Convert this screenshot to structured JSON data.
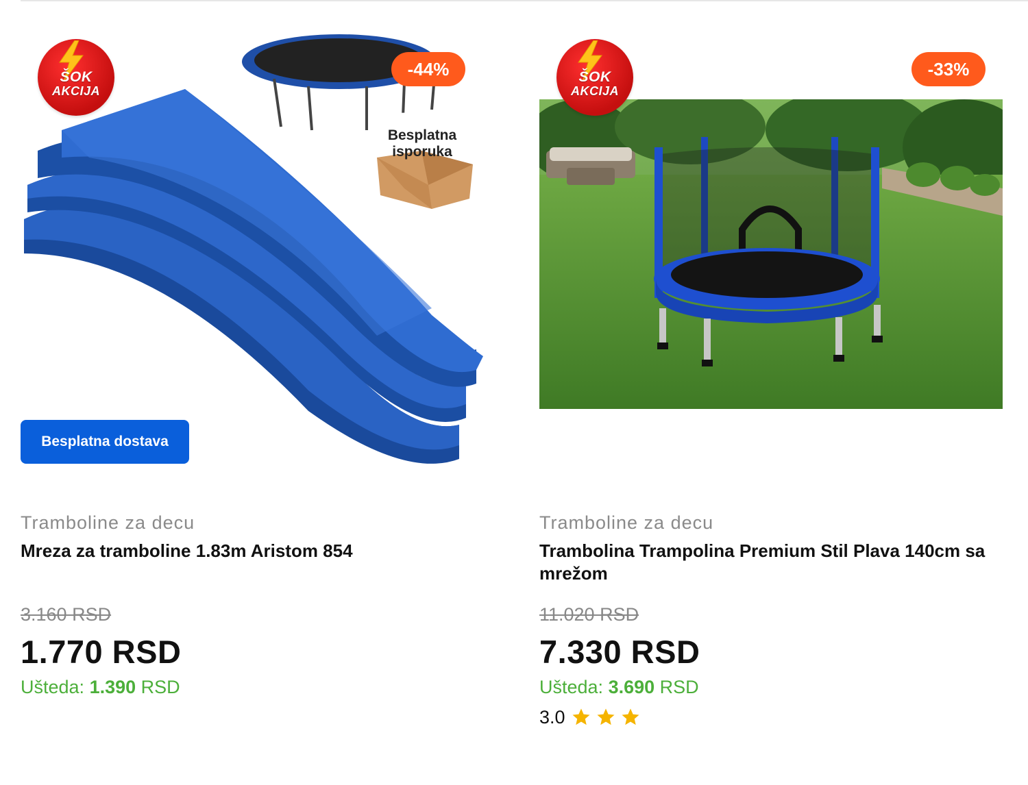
{
  "products": [
    {
      "badge": {
        "line1": "ŠOK",
        "line2": "AKCIJA"
      },
      "discount": "-44%",
      "image_overlay": {
        "line1": "Besplatna",
        "line2": "isporuka"
      },
      "free_delivery": "Besplatna dostava",
      "category": "Tramboline za decu",
      "title": "Mreza za tramboline 1.83m Aristom 854",
      "old_price": "3.160 RSD",
      "new_price": "1.770 RSD",
      "savings_label": "Ušteda:",
      "savings_amount": "1.390",
      "savings_currency": "RSD"
    },
    {
      "badge": {
        "line1": "ŠOK",
        "line2": "AKCIJA"
      },
      "discount": "-33%",
      "category": "Tramboline za decu",
      "title": "Trambolina Trampolina Premium Stil Plava 140cm sa mrežom",
      "old_price": "11.020 RSD",
      "new_price": "7.330 RSD",
      "savings_label": "Ušteda:",
      "savings_amount": "3.690",
      "savings_currency": "RSD",
      "rating": "3.0",
      "stars": 3
    }
  ],
  "colors": {
    "discount": "#ff5a1c",
    "free_delivery": "#0a5fdb",
    "savings": "#4caf3a",
    "badge_red": "#d41414",
    "star": "#f5b400"
  }
}
